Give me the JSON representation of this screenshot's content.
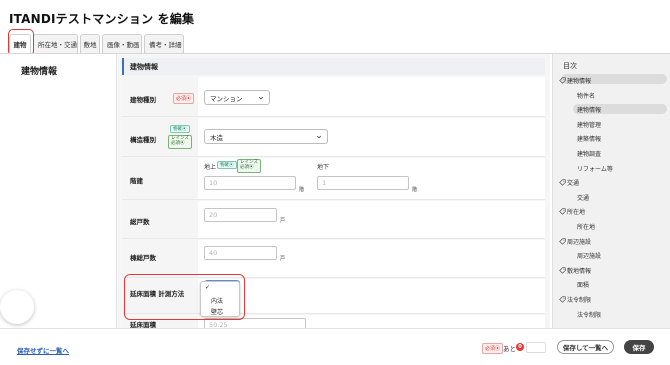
{
  "page": {
    "title": "ITANDIテストマンション を編集"
  },
  "tabs": [
    {
      "label": "建物"
    },
    {
      "label": "所在地・交通"
    },
    {
      "label": "敷地"
    },
    {
      "label": "画像・動画"
    },
    {
      "label": "備考・詳細"
    }
  ],
  "left": {
    "title": "建物情報"
  },
  "section": {
    "title": "建物情報"
  },
  "badges": {
    "required": "必須",
    "reins": "レインズ",
    "reins_line2": "必須",
    "bunkan": "物確",
    "check": "⦿"
  },
  "fields": {
    "building_type": {
      "label": "建物種別",
      "value": "マンション"
    },
    "structure": {
      "label": "構造種別",
      "value": "木造"
    },
    "floors": {
      "label": "階建",
      "above_label": "地上",
      "above_placeholder": "10",
      "above_unit": "階",
      "below_label": "地下",
      "below_placeholder": "1",
      "below_unit": "階"
    },
    "total_units": {
      "label": "総戸数",
      "placeholder": "20",
      "unit": "戸"
    },
    "building_units": {
      "label": "棟総戸数",
      "placeholder": "40",
      "unit": "戸"
    },
    "floor_area_method": {
      "label": "延床面積 計測方法",
      "options": [
        "内法",
        "壁芯"
      ]
    },
    "floor_area": {
      "label": "延床面積",
      "placeholder": "50.25"
    }
  },
  "toc": {
    "title": "目次",
    "items": [
      {
        "label": "建物情報",
        "level": "parent"
      },
      {
        "label": "物件名",
        "level": "child"
      },
      {
        "label": "建物情報",
        "level": "child"
      },
      {
        "label": "建物管理",
        "level": "child"
      },
      {
        "label": "建築情報",
        "level": "child"
      },
      {
        "label": "建物調査",
        "level": "child"
      },
      {
        "label": "リフォーム等",
        "level": "child"
      },
      {
        "label": "交通",
        "level": "parent"
      },
      {
        "label": "交通",
        "level": "child"
      },
      {
        "label": "所在地",
        "level": "parent"
      },
      {
        "label": "所在地",
        "level": "child"
      },
      {
        "label": "周辺施設",
        "level": "parent"
      },
      {
        "label": "周辺施設",
        "level": "child"
      },
      {
        "label": "敷地情報",
        "level": "parent"
      },
      {
        "label": "面積",
        "level": "child"
      },
      {
        "label": "法令制限",
        "level": "parent"
      },
      {
        "label": "法令制限",
        "level": "child"
      }
    ]
  },
  "footer": {
    "back_link": "保存せずに一覧へ",
    "required_badge": "必須",
    "remaining_prefix": "あと",
    "remaining_count": "0",
    "save_back": "保存して一覧へ",
    "save": "保存"
  }
}
